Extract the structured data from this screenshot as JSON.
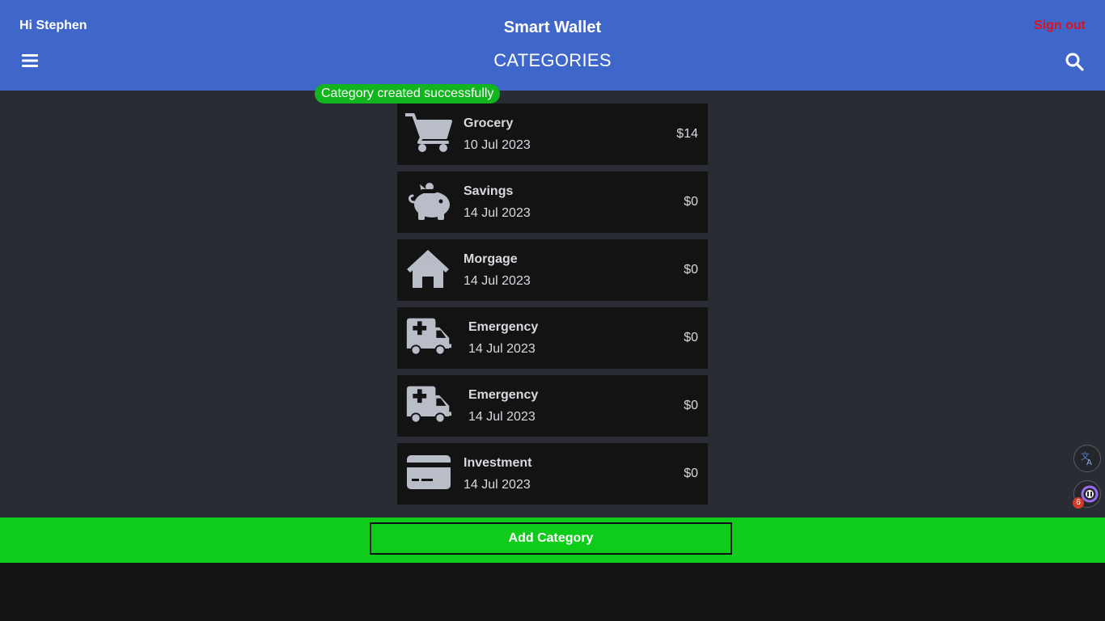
{
  "header": {
    "greeting": "Hi Stephen",
    "app_title": "Smart Wallet",
    "sign_out_label": "Sign out",
    "page_title": "CATEGORIES",
    "menu_icon": "hamburger-menu-icon",
    "search_icon": "search-icon"
  },
  "toast": {
    "message": "Category created successfully"
  },
  "categories": [
    {
      "name": "Grocery",
      "date": "10 Jul 2023",
      "amount": "$14",
      "icon": "shopping-cart-icon"
    },
    {
      "name": "Savings",
      "date": "14 Jul 2023",
      "amount": "$0",
      "icon": "piggy-bank-icon"
    },
    {
      "name": "Morgage",
      "date": "14 Jul 2023",
      "amount": "$0",
      "icon": "house-icon"
    },
    {
      "name": "Emergency",
      "date": "14 Jul 2023",
      "amount": "$0",
      "icon": "ambulance-icon"
    },
    {
      "name": "Emergency",
      "date": "14 Jul 2023",
      "amount": "$0",
      "icon": "ambulance-icon"
    },
    {
      "name": "Investment",
      "date": "14 Jul 2023",
      "amount": "$0",
      "icon": "credit-card-icon"
    }
  ],
  "footer": {
    "add_button_label": "Add Category"
  },
  "floating": {
    "translate_icon": "translate-icon",
    "extension_icon": "extension-icon",
    "extension_badge": "6"
  },
  "colors": {
    "header_bg": "#3e67c9",
    "content_bg": "#292c33",
    "card_bg": "#131314",
    "accent_green": "#0fcb1a",
    "toast_green": "#12b51e",
    "sign_out_red": "#e0101f",
    "icon_gray": "#b9bdc8"
  }
}
